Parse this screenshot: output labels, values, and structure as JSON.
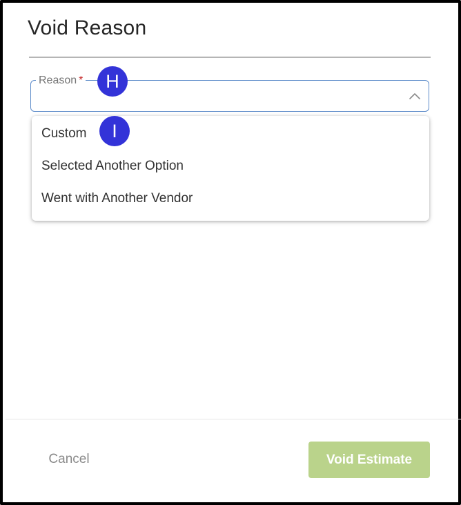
{
  "dialog": {
    "title": "Void Reason"
  },
  "reason_field": {
    "label": "Reason",
    "required_marker": "*",
    "value": "",
    "expanded": true
  },
  "dropdown": {
    "options": [
      "Custom",
      "Selected Another Option",
      "Went with Another Vendor"
    ]
  },
  "annotations": {
    "marker_h": "H",
    "marker_i": "I"
  },
  "footer": {
    "cancel_label": "Cancel",
    "submit_label": "Void Estimate",
    "submit_color": "#bad38b"
  },
  "icons": {
    "field_toggle": "chevron-up-icon"
  }
}
